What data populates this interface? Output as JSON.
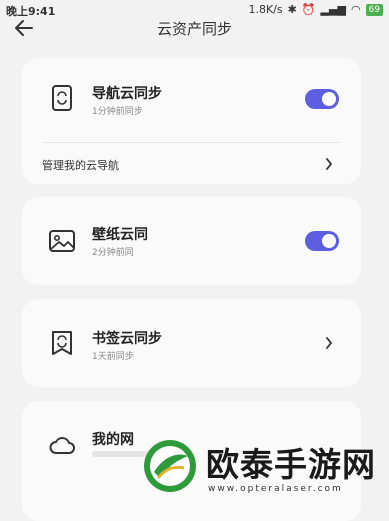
{
  "status": {
    "time": "晚上9:41",
    "speed": "1.8K/s",
    "battery": "69"
  },
  "header": {
    "title": "云资产同步"
  },
  "nav_card": {
    "name": "导航云同步",
    "sub": "1分钟前同步",
    "manage": "管理我的云导航",
    "toggle_on": true
  },
  "wallpaper_card": {
    "name": "壁纸云同",
    "sub": "2分钟前同",
    "toggle_on": true
  },
  "bookmark_card": {
    "name": "书签云同步",
    "sub": "1天前同步"
  },
  "drive_card": {
    "name": "我的网"
  },
  "watermark": {
    "text": "欧泰手游网",
    "url": "www.opteralaser.com"
  }
}
